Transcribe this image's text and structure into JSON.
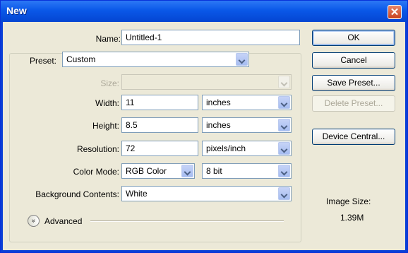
{
  "window": {
    "title": "New",
    "close_glyph": "✕"
  },
  "form": {
    "name": {
      "label": "Name:",
      "value": "Untitled-1"
    },
    "preset": {
      "label": "Preset:",
      "value": "Custom"
    },
    "size": {
      "label": "Size:",
      "value": ""
    },
    "width": {
      "label": "Width:",
      "value": "11",
      "unit": "inches"
    },
    "height": {
      "label": "Height:",
      "value": "8.5",
      "unit": "inches"
    },
    "resolution": {
      "label": "Resolution:",
      "value": "72",
      "unit": "pixels/inch"
    },
    "color_mode": {
      "label": "Color Mode:",
      "value": "RGB Color",
      "depth": "8 bit"
    },
    "background": {
      "label": "Background Contents:",
      "value": "White"
    },
    "advanced": {
      "label": "Advanced",
      "icon": "chevron-double-down-icon",
      "glyph": "»"
    }
  },
  "buttons": {
    "ok": "OK",
    "cancel": "Cancel",
    "save_preset": "Save Preset...",
    "delete_preset": "Delete Preset...",
    "device_central": "Device Central..."
  },
  "image_size": {
    "label": "Image Size:",
    "value": "1.39M"
  },
  "colors": {
    "titlebar": "#0a58e8",
    "dialog_bg": "#ece9d8",
    "close": "#c9431f"
  }
}
